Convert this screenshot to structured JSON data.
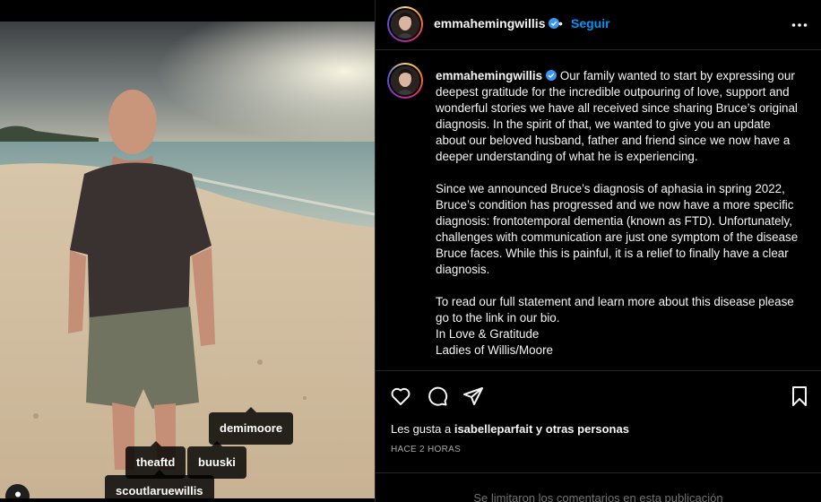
{
  "post": {
    "username": "emmahemingwillis",
    "verified": true,
    "separator": "•",
    "follow_label": "Seguir",
    "caption": {
      "p1": "Our family wanted to start by expressing our deepest gratitude for the incredible outpouring of love, support and wonderful stories we have all received since sharing Bruce’s original diagnosis. In the spirit of that, we wanted to give you an update about our beloved husband, father and friend since we now have a deeper understanding of what he is experiencing.",
      "p2": "Since we announced Bruce’s diagnosis of aphasia in spring 2022, Bruce’s condition has progressed and we now have a more specific diagnosis: frontotemporal dementia (known as FTD). Unfortunately, challenges with communication are just one symptom of the disease Bruce faces. While this is painful, it is a relief to finally have a clear diagnosis.",
      "p3_line1": "To read our full statement and learn more about this disease please go to the link in our bio.",
      "p3_line2": "In Love & Gratitude",
      "p3_line3": "Ladies of Willis/Moore"
    },
    "likes_prefix": "Les gusta a",
    "likes_user": "isabelleparfait",
    "likes_suffix": "y otras personas",
    "time_ago": "HACE 2 HORAS",
    "comments_note": "Se limitaron los comentarios en esta publicación"
  },
  "photo_tags": {
    "tag1": "demimoore",
    "tag2": "theaftd",
    "tag3": "buuski",
    "tag4": "scoutlaruewillis"
  },
  "icons": {
    "verified": "verified-badge-icon",
    "more": "more-options-icon",
    "like": "heart-icon",
    "comment": "comment-icon",
    "share": "paper-plane-icon",
    "save": "bookmark-icon",
    "user_tags": "user-tag-icon"
  },
  "colors": {
    "accent": "#0095f6",
    "verified": "#3897f0",
    "background": "#000000",
    "border": "#262626",
    "muted": "#a8a8a8"
  }
}
